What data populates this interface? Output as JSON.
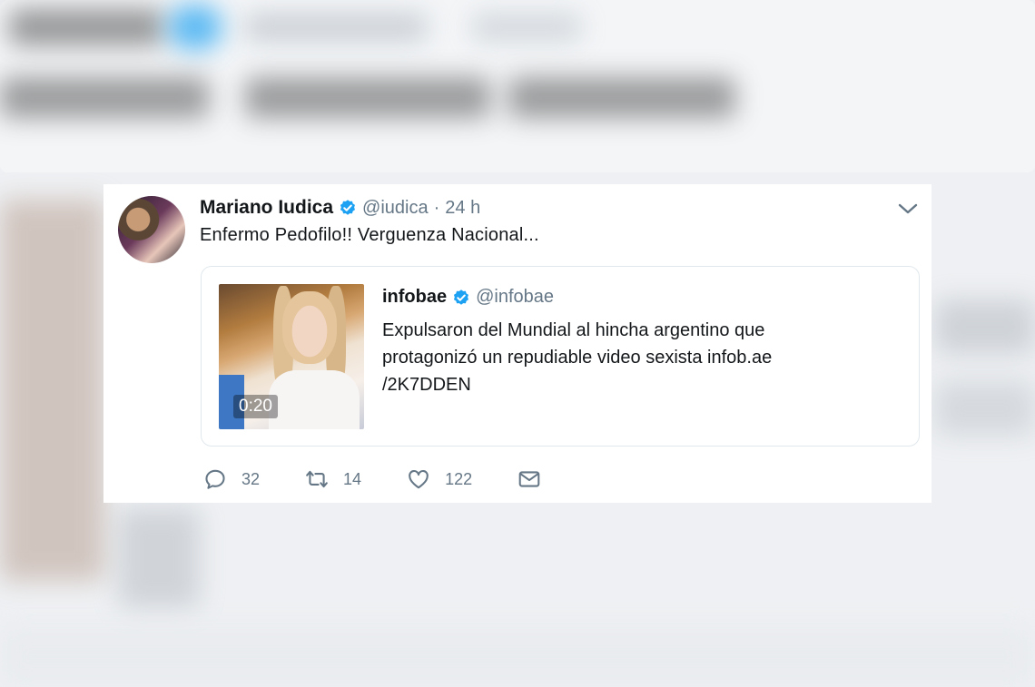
{
  "tweet": {
    "author_name": "Mariano Iudica",
    "author_handle": "@iudica",
    "separator": "·",
    "time": "24 h",
    "text": "Enfermo Pedofilo!! Verguenza Nacional...",
    "quoted": {
      "author_name": "infobae",
      "author_handle": "@infobae",
      "text_line1": "Expulsaron del Mundial al hincha argentino que",
      "text_line2": "protagonizó un repudiable video sexista infob.ae",
      "text_line3": "/2K7DDEN",
      "video_duration": "0:20"
    },
    "actions": {
      "reply_count": "32",
      "retweet_count": "14",
      "like_count": "122"
    }
  },
  "colors": {
    "accent": "#1da1f2",
    "text_primary": "#14171a",
    "text_secondary": "#657786",
    "border": "#e1e8ed"
  },
  "icons": {
    "verified": "verified-badge-icon",
    "menu": "chevron-down-icon",
    "reply": "reply-icon",
    "retweet": "retweet-icon",
    "like": "heart-icon",
    "dm": "envelope-icon"
  }
}
